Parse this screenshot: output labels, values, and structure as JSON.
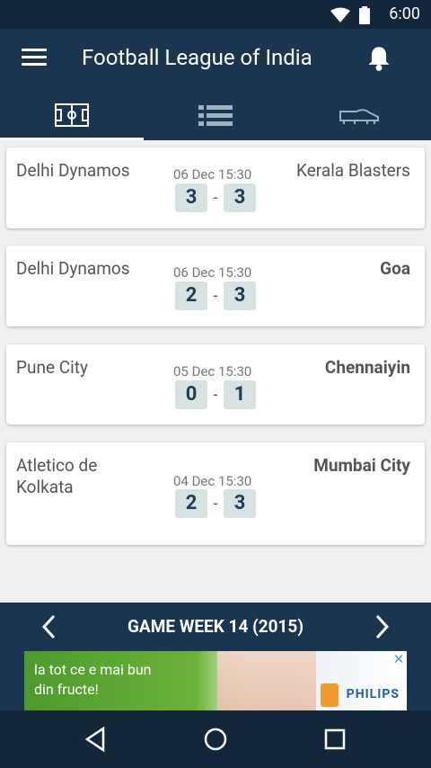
{
  "status": {
    "time": "6:00"
  },
  "app": {
    "title": "Football League of India"
  },
  "tabs": [
    {
      "icon": "field-icon",
      "active": true
    },
    {
      "icon": "list-icon",
      "active": false
    },
    {
      "icon": "boot-icon",
      "active": false
    }
  ],
  "matches": [
    {
      "home": "Delhi Dynamos",
      "away": "Kerala Blasters",
      "date": "06 Dec 15:30",
      "home_score": "3",
      "away_score": "3"
    },
    {
      "home": "Delhi Dynamos",
      "away": "Goa",
      "date": "06 Dec 15:30",
      "home_score": "2",
      "away_score": "3"
    },
    {
      "home": "Pune City",
      "away": "Chennaiyin",
      "date": "05 Dec 15:30",
      "home_score": "0",
      "away_score": "1"
    },
    {
      "home": "Atletico de Kolkata",
      "away": "Mumbai City",
      "date": "04 Dec 15:30",
      "home_score": "2",
      "away_score": "3"
    }
  ],
  "gameweek": {
    "label": "GAME WEEK 14 (2015)"
  },
  "ad": {
    "text_line1": "la tot ce e mai bun",
    "text_line2": "din fructe!",
    "brand": "PHILIPS",
    "close": "✕"
  },
  "colors": {
    "primary": "#1a3550",
    "statusbar": "#13273a",
    "score_box": "#d7e2e2",
    "background": "#f0f0f0"
  }
}
